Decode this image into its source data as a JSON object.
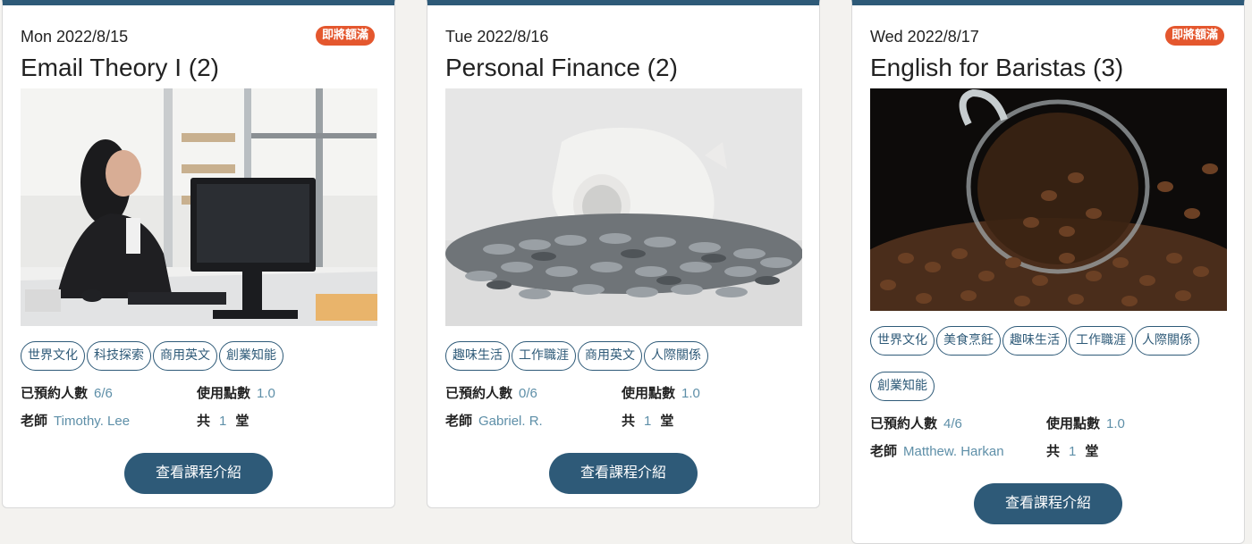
{
  "cards": [
    {
      "date": "Mon 2022/8/15",
      "badge": "即將額滿",
      "title": "Email Theory I (2)",
      "image": "woman-at-computer-office-photo",
      "tags": [
        "世界文化",
        "科技探索",
        "商用英文",
        "創業知能"
      ],
      "booked_label": "已預約人數",
      "booked_value": "6/6",
      "points_label": "使用點數",
      "points_value": "1.0",
      "teacher_label": "老師",
      "teacher_value": "Timothy. Lee",
      "sessions_prefix": "共",
      "sessions_value": "1",
      "sessions_suffix": "堂",
      "button": "查看課程介紹"
    },
    {
      "date": "Tue 2022/8/16",
      "badge": "",
      "title": "Personal Finance (2)",
      "image": "piggy-bank-coins-photo",
      "tags": [
        "趣味生活",
        "工作職涯",
        "商用英文",
        "人際關係"
      ],
      "booked_label": "已預約人數",
      "booked_value": "0/6",
      "points_label": "使用點數",
      "points_value": "1.0",
      "teacher_label": "老師",
      "teacher_value": "Gabriel. R.",
      "sessions_prefix": "共",
      "sessions_value": "1",
      "sessions_suffix": "堂",
      "button": "查看課程介紹"
    },
    {
      "date": "Wed 2022/8/17",
      "badge": "即將額滿",
      "title": "English for Baristas (3)",
      "image": "coffee-beans-glass-cup-photo",
      "tags": [
        "世界文化",
        "美食烹飪",
        "趣味生活",
        "工作職涯",
        "人際關係",
        "創業知能"
      ],
      "booked_label": "已預約人數",
      "booked_value": "4/6",
      "points_label": "使用點數",
      "points_value": "1.0",
      "teacher_label": "老師",
      "teacher_value": "Matthew. Harkan",
      "sessions_prefix": "共",
      "sessions_value": "1",
      "sessions_suffix": "堂",
      "button": "查看課程介紹"
    }
  ],
  "colors": {
    "primary": "#2e5a78",
    "badge": "#e4572e",
    "value": "#5e8fa8",
    "background": "#f3f2ef"
  }
}
